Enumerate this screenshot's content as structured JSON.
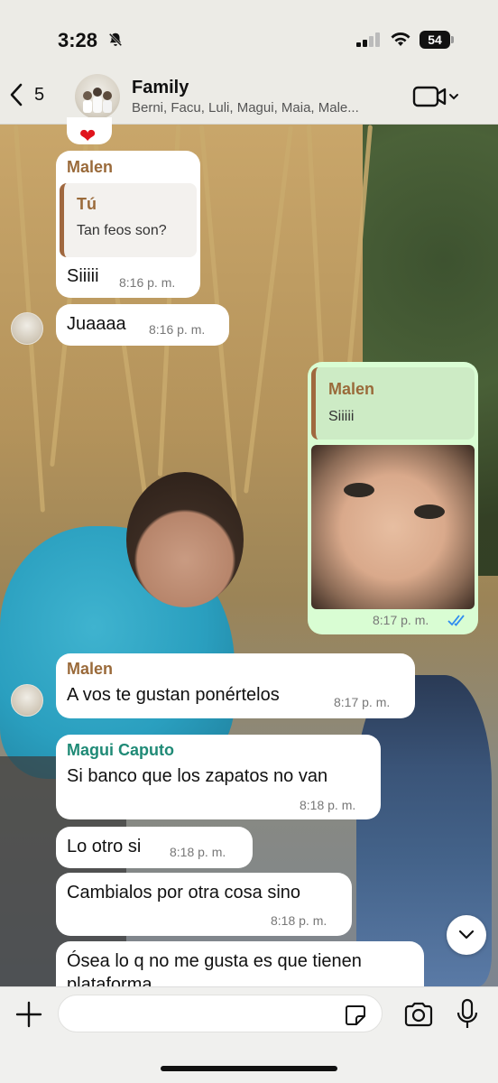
{
  "status_bar": {
    "time": "3:28",
    "battery": "54"
  },
  "header": {
    "back_count": "5",
    "title": "Family",
    "subtitle": "Berni, Facu, Luli, Magui, Maia, Male..."
  },
  "messages": [
    {
      "sender": "Malen",
      "quote_name": "Tú",
      "quote_text": "Tan feos son?",
      "text": "Siiiii",
      "time": "8:16 p. m."
    },
    {
      "text": "Juaaaa",
      "time": "8:16 p. m."
    },
    {
      "quote_name": "Malen",
      "quote_text": "Siiiii",
      "time": "8:17 p. m."
    },
    {
      "sender": "Malen",
      "text": "A vos te gustan ponértelos",
      "time": "8:17 p. m."
    },
    {
      "sender": "Magui Caputo",
      "text": "Si banco que los zapatos no van",
      "time": "8:18 p. m."
    },
    {
      "text": "Lo otro si",
      "time": "8:18 p. m."
    },
    {
      "text": "Cambialos por otra cosa sino",
      "time": "8:18 p. m."
    },
    {
      "text": "Ósea lo q no me gusta es que tienen plataforma"
    }
  ],
  "colors": {
    "malen": "#9a6a3a",
    "magui": "#1f8a76",
    "outgoing_bubble": "#d9fdd3",
    "read_ticks": "#2f8cf0"
  }
}
